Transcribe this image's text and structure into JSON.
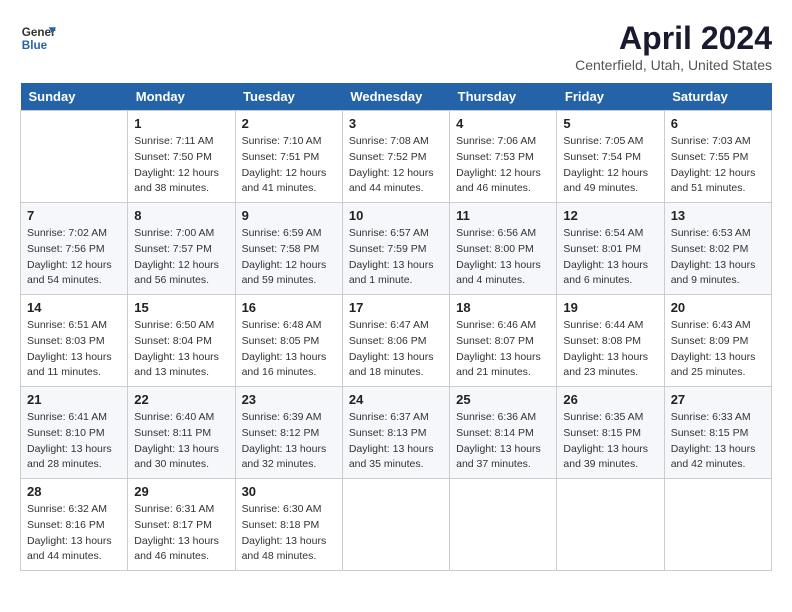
{
  "header": {
    "logo_general": "General",
    "logo_blue": "Blue",
    "title": "April 2024",
    "location": "Centerfield, Utah, United States"
  },
  "days": [
    "Sunday",
    "Monday",
    "Tuesday",
    "Wednesday",
    "Thursday",
    "Friday",
    "Saturday"
  ],
  "weeks": [
    [
      {
        "date": "",
        "info": ""
      },
      {
        "date": "1",
        "info": "Sunrise: 7:11 AM\nSunset: 7:50 PM\nDaylight: 12 hours\nand 38 minutes."
      },
      {
        "date": "2",
        "info": "Sunrise: 7:10 AM\nSunset: 7:51 PM\nDaylight: 12 hours\nand 41 minutes."
      },
      {
        "date": "3",
        "info": "Sunrise: 7:08 AM\nSunset: 7:52 PM\nDaylight: 12 hours\nand 44 minutes."
      },
      {
        "date": "4",
        "info": "Sunrise: 7:06 AM\nSunset: 7:53 PM\nDaylight: 12 hours\nand 46 minutes."
      },
      {
        "date": "5",
        "info": "Sunrise: 7:05 AM\nSunset: 7:54 PM\nDaylight: 12 hours\nand 49 minutes."
      },
      {
        "date": "6",
        "info": "Sunrise: 7:03 AM\nSunset: 7:55 PM\nDaylight: 12 hours\nand 51 minutes."
      }
    ],
    [
      {
        "date": "7",
        "info": "Sunrise: 7:02 AM\nSunset: 7:56 PM\nDaylight: 12 hours\nand 54 minutes."
      },
      {
        "date": "8",
        "info": "Sunrise: 7:00 AM\nSunset: 7:57 PM\nDaylight: 12 hours\nand 56 minutes."
      },
      {
        "date": "9",
        "info": "Sunrise: 6:59 AM\nSunset: 7:58 PM\nDaylight: 12 hours\nand 59 minutes."
      },
      {
        "date": "10",
        "info": "Sunrise: 6:57 AM\nSunset: 7:59 PM\nDaylight: 13 hours\nand 1 minute."
      },
      {
        "date": "11",
        "info": "Sunrise: 6:56 AM\nSunset: 8:00 PM\nDaylight: 13 hours\nand 4 minutes."
      },
      {
        "date": "12",
        "info": "Sunrise: 6:54 AM\nSunset: 8:01 PM\nDaylight: 13 hours\nand 6 minutes."
      },
      {
        "date": "13",
        "info": "Sunrise: 6:53 AM\nSunset: 8:02 PM\nDaylight: 13 hours\nand 9 minutes."
      }
    ],
    [
      {
        "date": "14",
        "info": "Sunrise: 6:51 AM\nSunset: 8:03 PM\nDaylight: 13 hours\nand 11 minutes."
      },
      {
        "date": "15",
        "info": "Sunrise: 6:50 AM\nSunset: 8:04 PM\nDaylight: 13 hours\nand 13 minutes."
      },
      {
        "date": "16",
        "info": "Sunrise: 6:48 AM\nSunset: 8:05 PM\nDaylight: 13 hours\nand 16 minutes."
      },
      {
        "date": "17",
        "info": "Sunrise: 6:47 AM\nSunset: 8:06 PM\nDaylight: 13 hours\nand 18 minutes."
      },
      {
        "date": "18",
        "info": "Sunrise: 6:46 AM\nSunset: 8:07 PM\nDaylight: 13 hours\nand 21 minutes."
      },
      {
        "date": "19",
        "info": "Sunrise: 6:44 AM\nSunset: 8:08 PM\nDaylight: 13 hours\nand 23 minutes."
      },
      {
        "date": "20",
        "info": "Sunrise: 6:43 AM\nSunset: 8:09 PM\nDaylight: 13 hours\nand 25 minutes."
      }
    ],
    [
      {
        "date": "21",
        "info": "Sunrise: 6:41 AM\nSunset: 8:10 PM\nDaylight: 13 hours\nand 28 minutes."
      },
      {
        "date": "22",
        "info": "Sunrise: 6:40 AM\nSunset: 8:11 PM\nDaylight: 13 hours\nand 30 minutes."
      },
      {
        "date": "23",
        "info": "Sunrise: 6:39 AM\nSunset: 8:12 PM\nDaylight: 13 hours\nand 32 minutes."
      },
      {
        "date": "24",
        "info": "Sunrise: 6:37 AM\nSunset: 8:13 PM\nDaylight: 13 hours\nand 35 minutes."
      },
      {
        "date": "25",
        "info": "Sunrise: 6:36 AM\nSunset: 8:14 PM\nDaylight: 13 hours\nand 37 minutes."
      },
      {
        "date": "26",
        "info": "Sunrise: 6:35 AM\nSunset: 8:15 PM\nDaylight: 13 hours\nand 39 minutes."
      },
      {
        "date": "27",
        "info": "Sunrise: 6:33 AM\nSunset: 8:15 PM\nDaylight: 13 hours\nand 42 minutes."
      }
    ],
    [
      {
        "date": "28",
        "info": "Sunrise: 6:32 AM\nSunset: 8:16 PM\nDaylight: 13 hours\nand 44 minutes."
      },
      {
        "date": "29",
        "info": "Sunrise: 6:31 AM\nSunset: 8:17 PM\nDaylight: 13 hours\nand 46 minutes."
      },
      {
        "date": "30",
        "info": "Sunrise: 6:30 AM\nSunset: 8:18 PM\nDaylight: 13 hours\nand 48 minutes."
      },
      {
        "date": "",
        "info": ""
      },
      {
        "date": "",
        "info": ""
      },
      {
        "date": "",
        "info": ""
      },
      {
        "date": "",
        "info": ""
      }
    ]
  ]
}
